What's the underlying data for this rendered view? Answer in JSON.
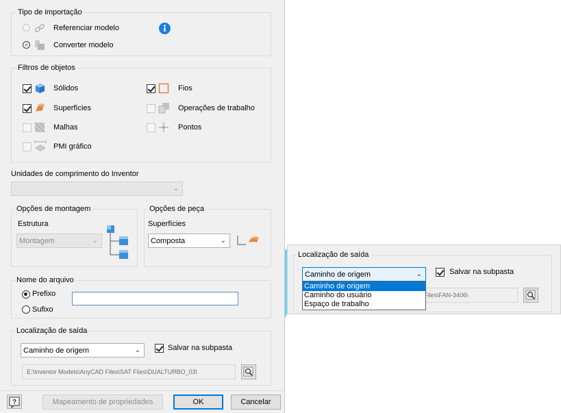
{
  "import_type": {
    "title": "Tipo de importação",
    "options": [
      {
        "label": "Referenciar modelo",
        "selected": false,
        "icon": "link-icon"
      },
      {
        "label": "Converter modelo",
        "selected": true,
        "icon": "convert-model-icon"
      }
    ],
    "info_icon": "info-icon"
  },
  "object_filters": {
    "title": "Filtros de objetos",
    "items": [
      {
        "label": "Sólidos",
        "checked": true,
        "icon": "solid-cube-icon"
      },
      {
        "label": "Fios",
        "checked": true,
        "icon": "wire-icon"
      },
      {
        "label": "Superfícies",
        "checked": true,
        "icon": "surface-icon"
      },
      {
        "label": "Operações de trabalho",
        "checked": false,
        "icon": "work-features-icon"
      },
      {
        "label": "Malhas",
        "checked": false,
        "icon": "mesh-icon"
      },
      {
        "label": "Pontos",
        "checked": false,
        "icon": "point-icon"
      },
      {
        "label": "PMI gráfico",
        "checked": false,
        "icon": "graphic-pmi-icon"
      }
    ]
  },
  "units": {
    "title": "Unidades de comprimento do Inventor",
    "value": ""
  },
  "assembly_options": {
    "title": "Opções de montagem",
    "structure_label": "Estrutura",
    "structure_value": "Montagem"
  },
  "part_options": {
    "title": "Opções de peça",
    "surfaces_label": "Superfícies",
    "surfaces_value": "Composta"
  },
  "file_name": {
    "title": "Nome do arquivo",
    "prefix_label": "Prefixo",
    "suffix_label": "Sufixo",
    "prefix_selected": true,
    "value": ""
  },
  "output_location": {
    "title": "Localização de saída",
    "value": "Caminho de origem",
    "save_subfolder_label": "Salvar na subpasta",
    "save_subfolder_checked": true,
    "path": "E:\\Inventor Models\\AnyCAD Files\\SAT Files\\DUALTURBO_03\\"
  },
  "footer": {
    "property_mapping_label": "Mapeamento de propriedades",
    "ok_label": "OK",
    "cancel_label": "Cancelar"
  },
  "zoom": {
    "title": "Localização de saída",
    "value": "Caminho de origem",
    "save_subfolder_label": "Salvar na subpasta",
    "path_fragment": "Files\\FAN-3406\\",
    "dropdown_options": [
      "Caminho de origem",
      "Caminho do usuário",
      "Espaço de trabalho"
    ],
    "dropdown_selected": "Caminho de origem"
  },
  "colors": {
    "accent": "#0078d7",
    "callout": "#5bcdf3",
    "dialog_bg": "#f0f0f0"
  }
}
